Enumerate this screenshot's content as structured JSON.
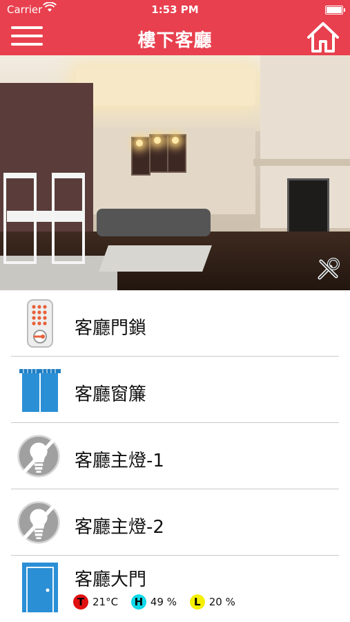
{
  "status_bar": {
    "carrier": "Carrier",
    "time": "1:53 PM"
  },
  "nav": {
    "title": "樓下客廳",
    "menu_icon": "hamburger-menu-icon",
    "home_icon": "home-icon",
    "background_color": "#e8404e"
  },
  "hero": {
    "tools_icon": "wrench-screwdriver-icon"
  },
  "devices": [
    {
      "label": "客廳門鎖",
      "icon": "door-lock-keypad-icon"
    },
    {
      "label": "客廳窗簾",
      "icon": "curtain-icon"
    },
    {
      "label": "客廳主燈-1",
      "icon": "light-bulb-off-icon"
    },
    {
      "label": "客廳主燈-2",
      "icon": "light-bulb-off-icon"
    },
    {
      "label": "客廳大門",
      "icon": "door-icon"
    }
  ],
  "sensors": [
    {
      "badge": "T",
      "value": "21°C",
      "color": "#e01010",
      "text_color": "#000000"
    },
    {
      "badge": "H",
      "value": "49 %",
      "color": "#10d8e8",
      "text_color": "#000000"
    },
    {
      "badge": "L",
      "value": "20 %",
      "color": "#f5f000",
      "text_color": "#000000"
    }
  ]
}
